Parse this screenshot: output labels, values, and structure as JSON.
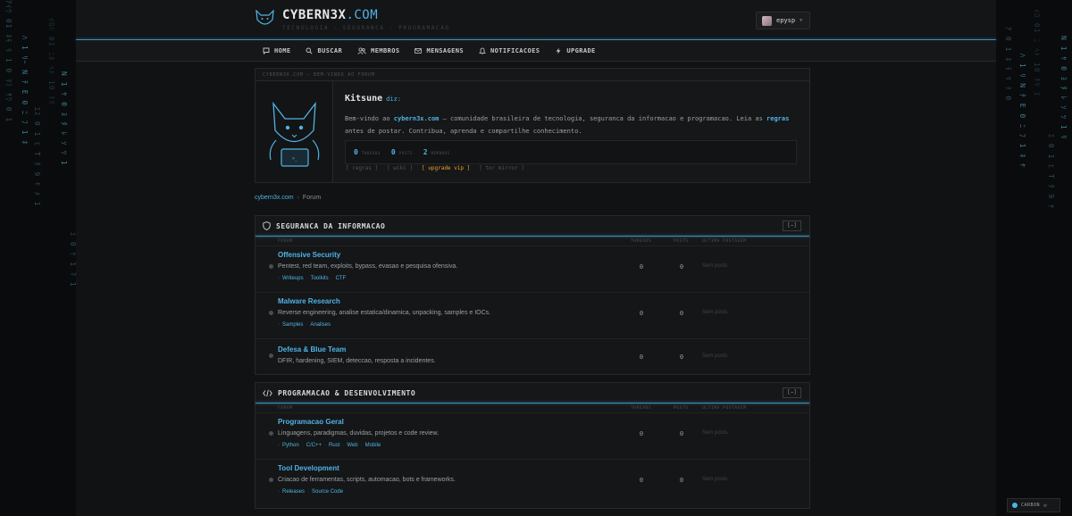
{
  "brand": {
    "name": "CYBERN3X",
    "tld": ".COM",
    "tagline": "TECNOLOGIA · SEGURANCA · PROGRAMACAO"
  },
  "user": {
    "name": "epysp"
  },
  "nav": [
    {
      "label": "HOME",
      "icon": "chat-icon"
    },
    {
      "label": "BUSCAR",
      "icon": "search-icon"
    },
    {
      "label": "MEMBROS",
      "icon": "members-icon"
    },
    {
      "label": "MENSAGENS",
      "icon": "mail-icon"
    },
    {
      "label": "NOTIFICACOES",
      "icon": "bell-icon"
    },
    {
      "label": "UPGRADE",
      "icon": "bolt-icon"
    }
  ],
  "intro": {
    "header": "CYBERN3X.COM — BEM-VINDO AO FORUM",
    "author": "Kitsune",
    "says": "diz:",
    "text_1": "Bem-vindo ao ",
    "site": "cybern3x.com",
    "text_2": " — comunidade brasileira de tecnologia, seguranca da informacao e programacao. Leia as ",
    "rules": "regras",
    "text_3": " antes de postar. Contribua, aprenda e compartilhe conhecimento.",
    "stats": [
      {
        "value": "0",
        "label": "THREADS"
      },
      {
        "value": "0",
        "label": "POSTS"
      },
      {
        "value": "2",
        "label": "MEMBROS"
      }
    ],
    "links": [
      "[ regras ]",
      "[ wiki ]",
      "[ upgrade vip ]",
      "[ tor mirror ]"
    ]
  },
  "breadcrumb": {
    "home": "cybern3x.com",
    "sep": "›",
    "current": "Forum"
  },
  "columns": {
    "forum": "FORUM",
    "threads": "THREADS",
    "posts": "POSTS",
    "last": "ULTIMA POSTAGEM"
  },
  "categories": [
    {
      "title": "SEGURANCA DA INFORMACAO",
      "icon": "shield-icon",
      "collapse": "[−]",
      "forums": [
        {
          "name": "Offensive Security",
          "desc": "Pentest, red team, exploits, bypass, evasao e pesquisa ofensiva.",
          "subs": [
            "Writeups",
            "Toolkits",
            "CTF"
          ],
          "threads": "0",
          "posts": "0",
          "last": "Sem posts"
        },
        {
          "name": "Malware Research",
          "desc": "Reverse engineering, analise estatica/dinamica, unpacking, samples e IOCs.",
          "subs": [
            "Samples",
            "Analises"
          ],
          "threads": "0",
          "posts": "0",
          "last": "Sem posts"
        },
        {
          "name": "Defesa & Blue Team",
          "desc": "DFIR, hardening, SIEM, deteccao, resposta a incidentes.",
          "subs": [],
          "threads": "0",
          "posts": "0",
          "last": "Sem posts"
        }
      ]
    },
    {
      "title": "PROGRAMACAO & DESENVOLVIMENTO",
      "icon": "code-icon",
      "collapse": "[−]",
      "forums": [
        {
          "name": "Programacao Geral",
          "desc": "Linguagens, paradigmas, duvidas, projetos e code review.",
          "subs": [
            "Python",
            "C/C++",
            "Rust",
            "Web",
            "Mobile"
          ],
          "threads": "0",
          "posts": "0",
          "last": "Sem posts"
        },
        {
          "name": "Tool Development",
          "desc": "Criacao de ferramentas, scripts, automacao, bots e frameworks.",
          "subs": [
            "Releases",
            "Source Code"
          ],
          "threads": "0",
          "posts": "0",
          "last": "Sem posts"
        }
      ]
    }
  ],
  "theme": {
    "label": "CARBON"
  },
  "colors": {
    "accent": "#4fb3e6",
    "vip": "#f0a030",
    "background": "#111213"
  }
}
